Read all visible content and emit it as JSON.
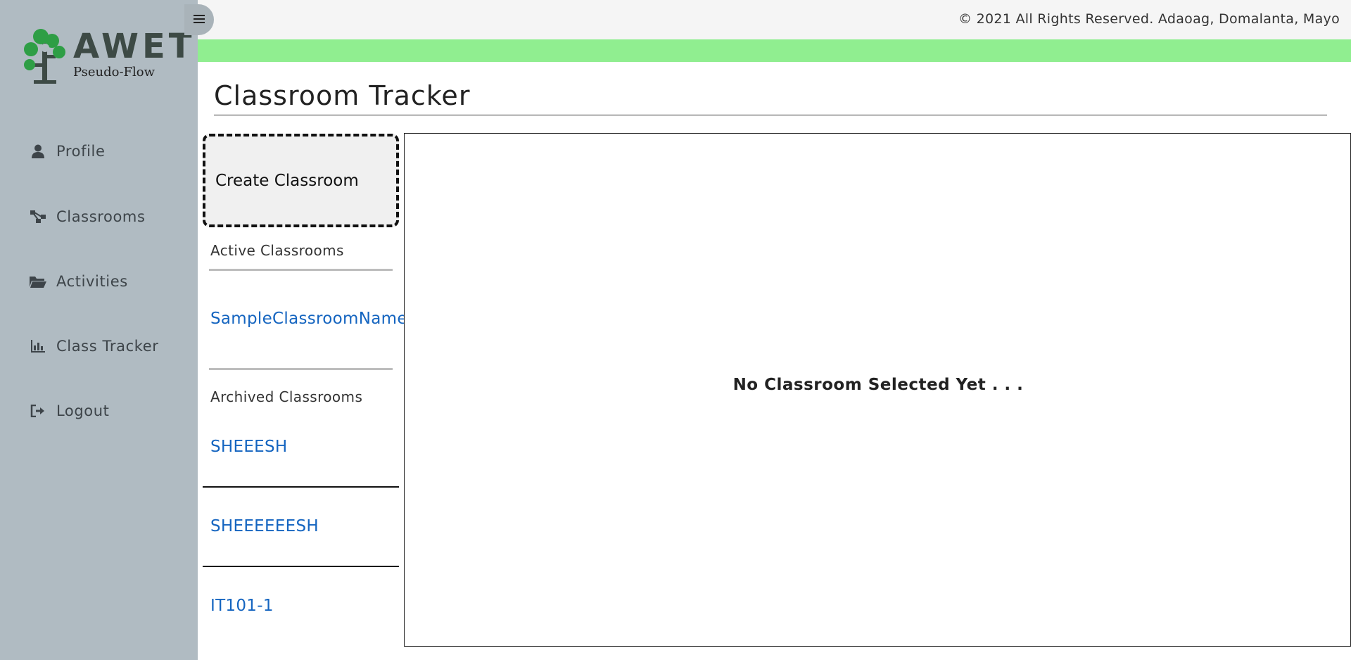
{
  "brand": {
    "name": "AWET",
    "subtitle": "Pseudo-Flow",
    "colors": {
      "tree_green": "#2e9e45",
      "tree_trunk": "#3d4a45"
    }
  },
  "sidebar": {
    "items": [
      {
        "label": "Profile",
        "icon": "user-icon"
      },
      {
        "label": "Classrooms",
        "icon": "sitemap-icon"
      },
      {
        "label": "Activities",
        "icon": "folder-open-icon"
      },
      {
        "label": "Class Tracker",
        "icon": "chart-bar-icon"
      },
      {
        "label": "Logout",
        "icon": "sign-out-icon"
      }
    ]
  },
  "header": {
    "toggle_icon": "hamburger-icon",
    "copyright": "© 2021 All Rights Reserved. Adaoag, Domalanta, Mayo",
    "accent_color": "#90ee90"
  },
  "main": {
    "title": "Classroom Tracker",
    "create_button": "Create Classroom",
    "active_label": "Active Classrooms",
    "active_classrooms": [
      "SampleClassroomName"
    ],
    "archived_label": "Archived Classrooms",
    "archived_classrooms": [
      "SHEEESH",
      "SHEEEEEESH",
      "IT101-1"
    ],
    "empty_message": "No Classroom Selected Yet . . ."
  }
}
